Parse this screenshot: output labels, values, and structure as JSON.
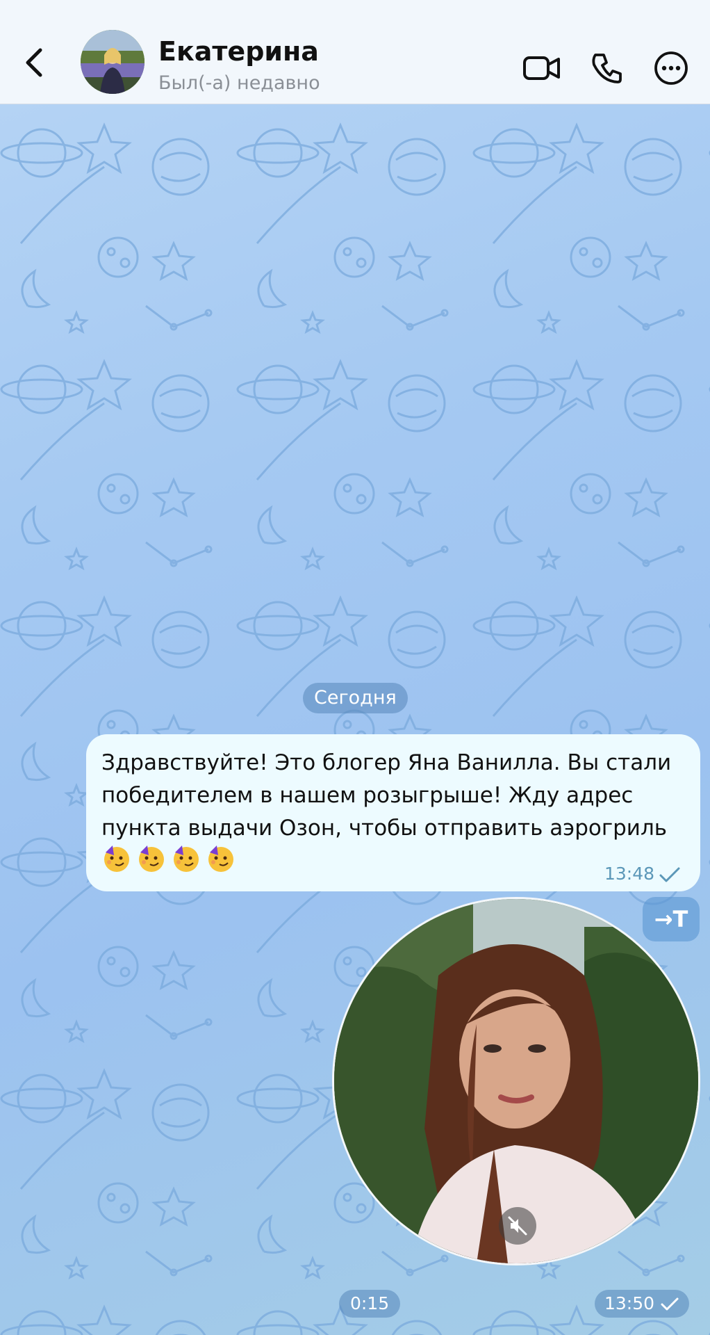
{
  "header": {
    "contact_name": "Екатерина",
    "status": "Был(-а) недавно",
    "back_icon": "chevron-left-icon",
    "video_icon": "video-camera-icon",
    "call_icon": "phone-icon",
    "more_icon": "more-dots-icon"
  },
  "chat": {
    "date_separator": "Сегодня",
    "message": {
      "text": "Здравствуйте! Это блогер Яна Ванилла. Вы стали победителем в нашем розыгрыше! Жду адрес пункта выдачи Озон, чтобы отправить аэрогриль",
      "emoji": [
        "🥳",
        "🥳",
        "🥳",
        "🥳"
      ],
      "time": "13:48",
      "status_icon": "single-check-icon"
    },
    "translate_button": "→T",
    "video_message": {
      "duration": "0:15",
      "time": "13:50",
      "mute_icon": "speaker-muted-icon",
      "status_icon": "single-check-icon"
    }
  },
  "colors": {
    "header_bg": "#f2f7fc",
    "bubble_bg": "#edfbff",
    "accent": "#2b8fd6",
    "chat_bg": "#a5c9f2"
  }
}
